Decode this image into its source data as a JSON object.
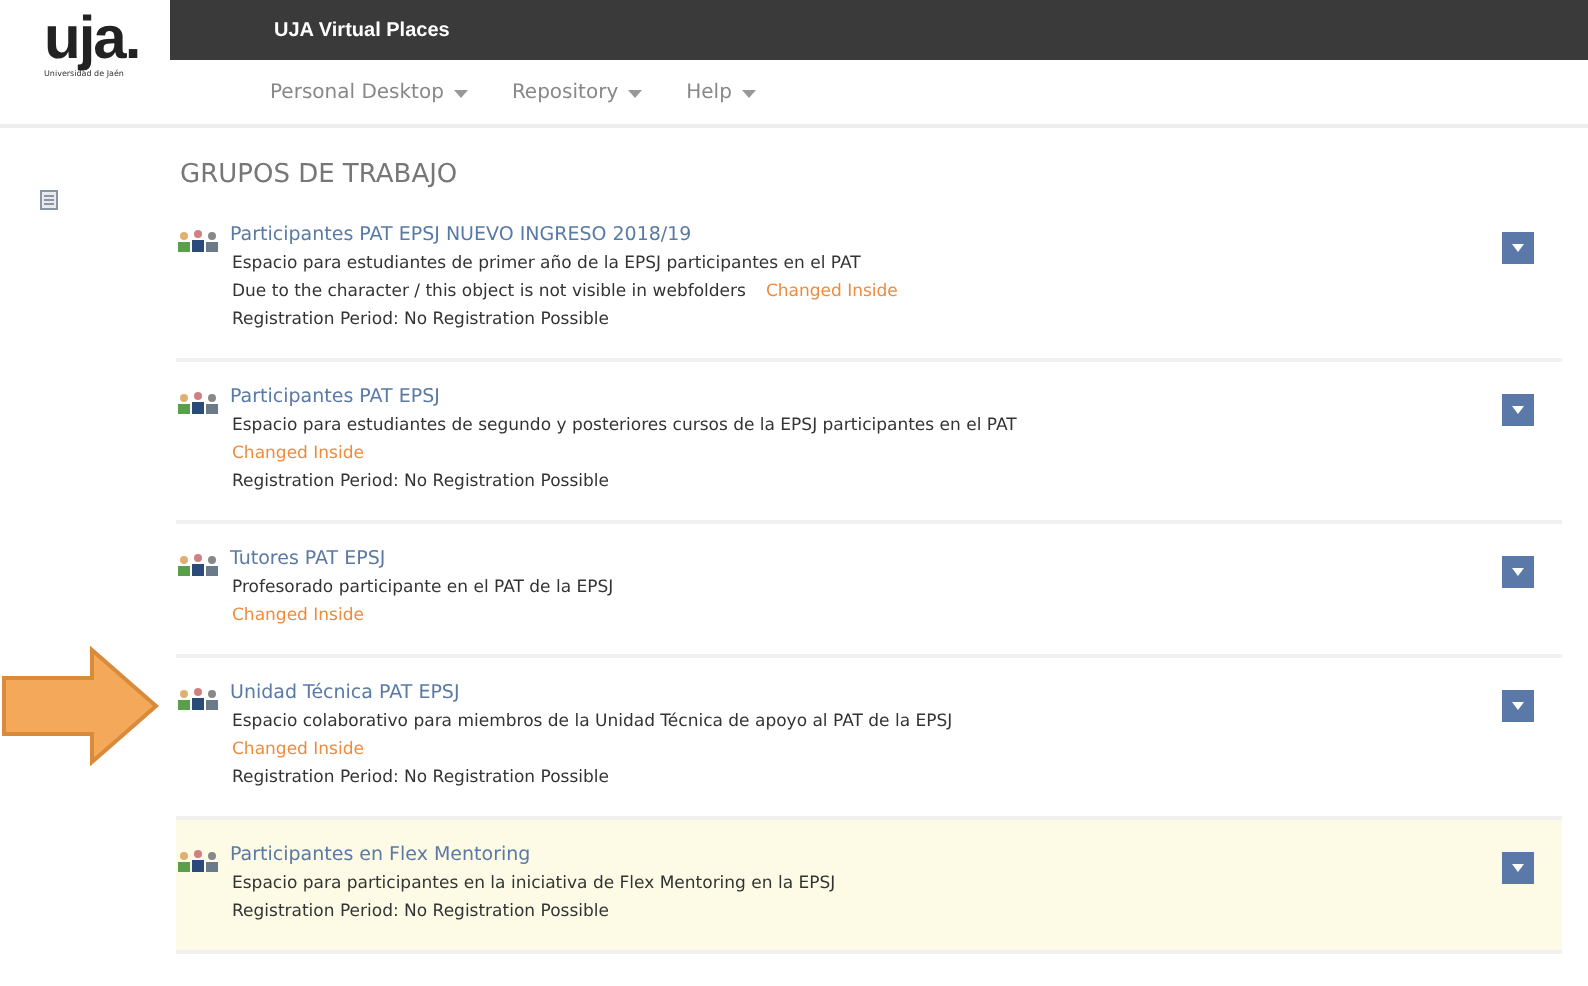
{
  "logo": {
    "mark": "uja.",
    "caption": "Universidad de Jaén"
  },
  "header": {
    "title": "UJA Virtual Places"
  },
  "nav": [
    {
      "label": "Personal Desktop"
    },
    {
      "label": "Repository"
    },
    {
      "label": "Help"
    }
  ],
  "section": {
    "title": "GRUPOS DE TRABAJO"
  },
  "items": [
    {
      "title": "Participantes PAT EPSJ NUEVO INGRESO 2018/19",
      "description": "Espacio para estudiantes de primer año de la EPSJ participantes en el PAT",
      "notice": "Due to the character / this object is not visible in webfolders",
      "status": "Changed Inside",
      "registration": "Registration Period: No Registration Possible",
      "highlighted": false,
      "pointed": false
    },
    {
      "title": "Participantes PAT EPSJ",
      "description": "Espacio para estudiantes de segundo y posteriores cursos de la EPSJ participantes en el PAT",
      "status": "Changed Inside",
      "registration": "Registration Period: No Registration Possible",
      "highlighted": false,
      "pointed": false
    },
    {
      "title": "Tutores PAT EPSJ",
      "description": "Profesorado participante en el PAT de la EPSJ",
      "status": "Changed Inside",
      "highlighted": false,
      "pointed": false
    },
    {
      "title": "Unidad Técnica PAT EPSJ",
      "description": "Espacio colaborativo para miembros de la Unidad Técnica de apoyo al PAT de la EPSJ",
      "status": "Changed Inside",
      "registration": "Registration Period: No Registration Possible",
      "highlighted": false,
      "pointed": true
    },
    {
      "title": "Participantes en Flex Mentoring",
      "description": "Espacio para participantes en la iniciativa de Flex Mentoring en la EPSJ",
      "registration": "Registration Period: No Registration Possible",
      "highlighted": true,
      "pointed": false
    }
  ]
}
